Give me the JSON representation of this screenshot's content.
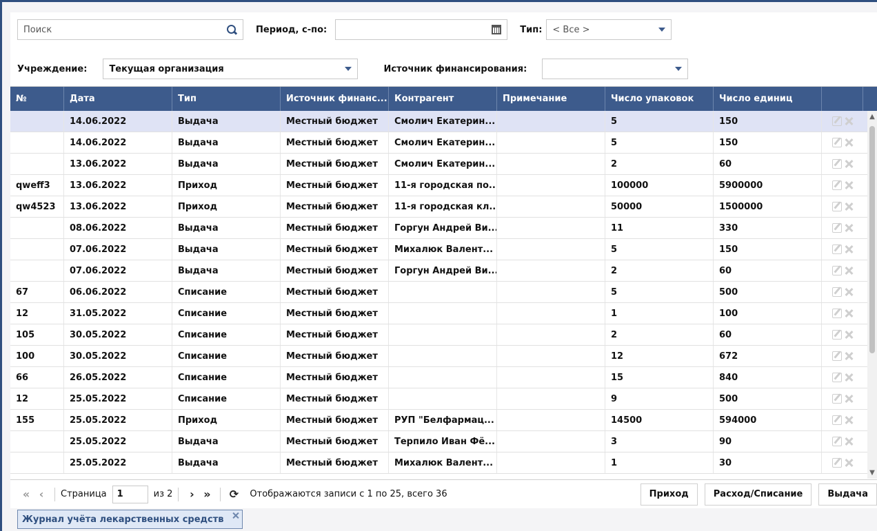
{
  "filters": {
    "search_placeholder": "Поиск",
    "period_label": "Период, с-по:",
    "type_label": "Тип:",
    "type_value": "< Все >",
    "institution_label": "Учреждение:",
    "institution_value": "Текущая организация",
    "funding_label": "Источник финансирования:",
    "funding_value": ""
  },
  "grid": {
    "columns": [
      "№",
      "Дата",
      "Тип",
      "Источник финанс...",
      "Контрагент",
      "Примечание",
      "Число упаковок",
      "Число единиц",
      ""
    ],
    "rows": [
      [
        "",
        "14.06.2022",
        "Выдача",
        "Местный бюджет",
        "Смолич Екатерин...",
        "",
        "5",
        "150"
      ],
      [
        "",
        "14.06.2022",
        "Выдача",
        "Местный бюджет",
        "Смолич Екатерин...",
        "",
        "5",
        "150"
      ],
      [
        "",
        "13.06.2022",
        "Выдача",
        "Местный бюджет",
        "Смолич Екатерин...",
        "",
        "2",
        "60"
      ],
      [
        "qweff3",
        "13.06.2022",
        "Приход",
        "Местный бюджет",
        "11-я городская по...",
        "",
        "100000",
        "5900000"
      ],
      [
        "qw4523",
        "13.06.2022",
        "Приход",
        "Местный бюджет",
        "11-я городская кл...",
        "",
        "50000",
        "1500000"
      ],
      [
        "",
        "08.06.2022",
        "Выдача",
        "Местный бюджет",
        "Горгун Андрей Ви...",
        "",
        "11",
        "330"
      ],
      [
        "",
        "07.06.2022",
        "Выдача",
        "Местный бюджет",
        "Михалюк Валент...",
        "",
        "5",
        "150"
      ],
      [
        "",
        "07.06.2022",
        "Выдача",
        "Местный бюджет",
        "Горгун Андрей Ви...",
        "",
        "2",
        "60"
      ],
      [
        "67",
        "06.06.2022",
        "Списание",
        "Местный бюджет",
        "",
        "",
        "5",
        "500"
      ],
      [
        "12",
        "31.05.2022",
        "Списание",
        "Местный бюджет",
        "",
        "",
        "1",
        "100"
      ],
      [
        "105",
        "30.05.2022",
        "Списание",
        "Местный бюджет",
        "",
        "",
        "2",
        "60"
      ],
      [
        "100",
        "30.05.2022",
        "Списание",
        "Местный бюджет",
        "",
        "",
        "12",
        "672"
      ],
      [
        "66",
        "26.05.2022",
        "Списание",
        "Местный бюджет",
        "",
        "",
        "15",
        "840"
      ],
      [
        "12",
        "25.05.2022",
        "Списание",
        "Местный бюджет",
        "",
        "",
        "9",
        "500"
      ],
      [
        "155",
        "25.05.2022",
        "Приход",
        "Местный бюджет",
        "РУП \"Белфармац...",
        "",
        "14500",
        "594000"
      ],
      [
        "",
        "25.05.2022",
        "Выдача",
        "Местный бюджет",
        "Терпило Иван Фё...",
        "",
        "3",
        "90"
      ],
      [
        "",
        "25.05.2022",
        "Выдача",
        "Местный бюджет",
        "Михалюк Валент...",
        "",
        "1",
        "30"
      ]
    ]
  },
  "pager": {
    "page_label": "Страница",
    "page_value": "1",
    "of_label": "из 2",
    "status_text": "Отображаются записи с 1 по 25, всего 36",
    "btn_income": "Приход",
    "btn_expense": "Расход/Списание",
    "btn_issue": "Выдача"
  },
  "tab": {
    "label": "Журнал учёта лекарственных средств"
  },
  "colors": {
    "header_bg": "#3d5b8c",
    "selected_row": "#dfe3f5"
  }
}
